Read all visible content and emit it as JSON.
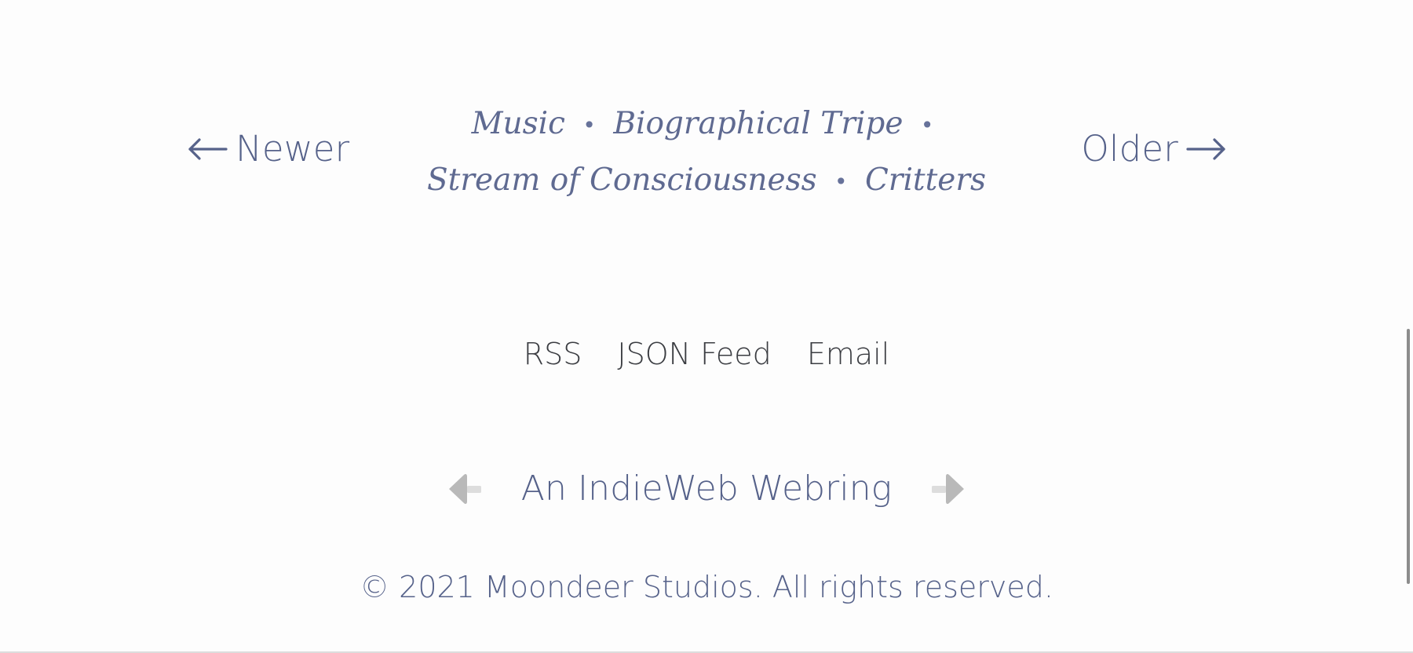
{
  "navigation": {
    "newer_label": "Newer",
    "older_label": "Older"
  },
  "categories": {
    "items": [
      "Music",
      "Biographical Tripe",
      "Stream of Consciousness",
      "Critters"
    ],
    "separator": "•"
  },
  "feeds": {
    "rss_label": "RSS",
    "json_feed_label": "JSON Feed",
    "email_label": "Email"
  },
  "webring": {
    "title": "An IndieWeb Webring",
    "previous_icon": "left-arrow-icon",
    "next_icon": "right-arrow-icon"
  },
  "footer": {
    "copyright": "© 2021 Moondeer Studios. All rights reserved."
  },
  "colors": {
    "background": "#fdfdfd",
    "primary_text": "#56628a",
    "feed_text": "#3b3d42",
    "webring_icon": "#b9b9b9",
    "scrollbar": "#8c8c8c"
  }
}
